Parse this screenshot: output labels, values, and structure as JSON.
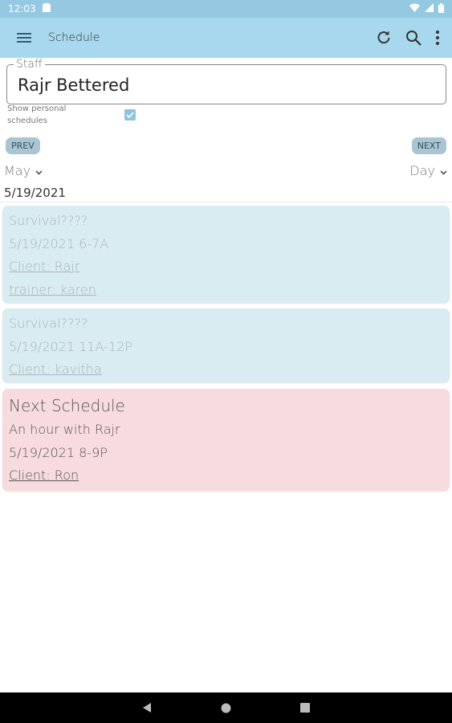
{
  "status_bar": {
    "time": "12:03"
  },
  "app_bar": {
    "title": "Schedule"
  },
  "staff": {
    "label": "Staff",
    "value": "Rajr Bettered"
  },
  "personal": {
    "label": "Show personal schedules",
    "checked": true
  },
  "nav": {
    "prev_label": "PREV",
    "next_label": "NEXT"
  },
  "filters": {
    "month": "May",
    "view": "Day"
  },
  "date": "5/19/2021",
  "schedules": [
    {
      "title": "Survival????",
      "time": "5/19/2021 6-7A",
      "client": "Client: Rajr",
      "trainer": "trainer: karen"
    },
    {
      "title": "Survival????",
      "time": "5/19/2021 11A-12P",
      "client": "Client: kavitha"
    },
    {
      "title": "Next Schedule",
      "subtitle": "An hour with Rajr",
      "time": "5/19/2021 8-9P",
      "client": "Client: Ron"
    }
  ],
  "colors": {
    "app_bar": "#a7d8ee",
    "status_bar": "#95c9e2",
    "past_card": "#d9ecf2",
    "next_card": "#f7dbde",
    "checkbox": "#8fc3df"
  }
}
